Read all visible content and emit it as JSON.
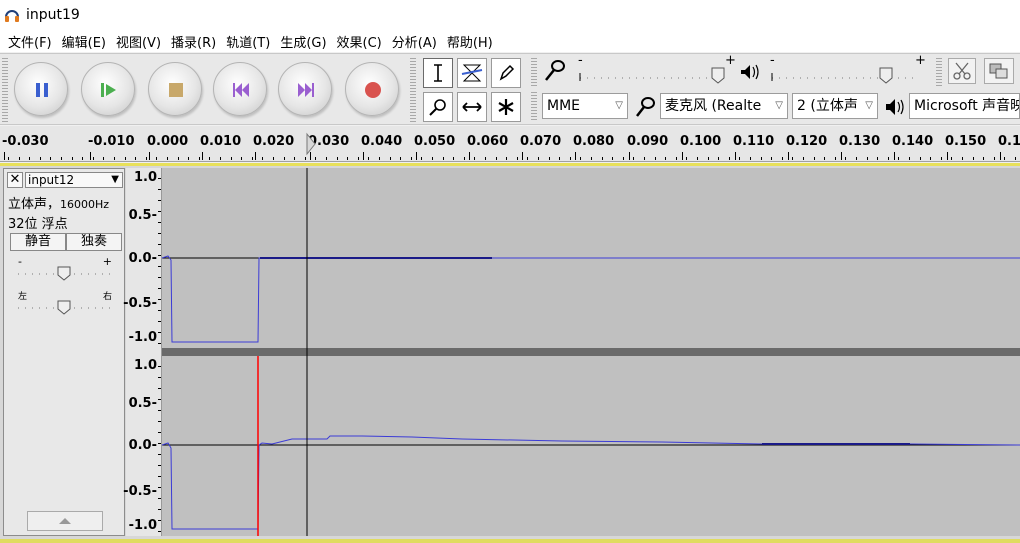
{
  "window": {
    "title": "input19"
  },
  "menu": [
    "文件(F)",
    "编辑(E)",
    "视图(V)",
    "播录(R)",
    "轨道(T)",
    "生成(G)",
    "效果(C)",
    "分析(A)",
    "帮助(H)"
  ],
  "toolbar": {
    "transport": [
      "pause",
      "play",
      "stop",
      "skip-to-start",
      "skip-to-end",
      "record"
    ],
    "meter_marks": {
      "minus": "-",
      "plus": "+"
    },
    "host": "MME",
    "input_device": "麦克风 (Realte",
    "channels": "2 (立体声",
    "output_device": "Microsoft 声音映"
  },
  "ruler": {
    "labels": [
      "-0.030",
      "-0.010",
      "0.000",
      "0.010",
      "0.020",
      "0.030",
      "0.040",
      "0.050",
      "0.060",
      "0.070",
      "0.080",
      "0.090",
      "0.100",
      "0.110",
      "0.120",
      "0.130",
      "0.140",
      "0.150",
      "0.1"
    ]
  },
  "track": {
    "name": "input12",
    "format_line1": "立体声，",
    "rate": "16000Hz",
    "format_line2": "32位 浮点",
    "mute_label": "静音",
    "solo_label": "独奏",
    "gain_minus": "-",
    "gain_plus": "+",
    "pan_left": "左",
    "pan_right": "右",
    "channel_scale": [
      "1.0",
      "0.5-",
      "0.0-",
      "-0.5-",
      "-1.0"
    ]
  },
  "colors": {
    "waveform": "#3b3bd6",
    "cursor_line": "#000000",
    "red_marker": "#ff0000",
    "track_bg": "#c0c0c0"
  }
}
